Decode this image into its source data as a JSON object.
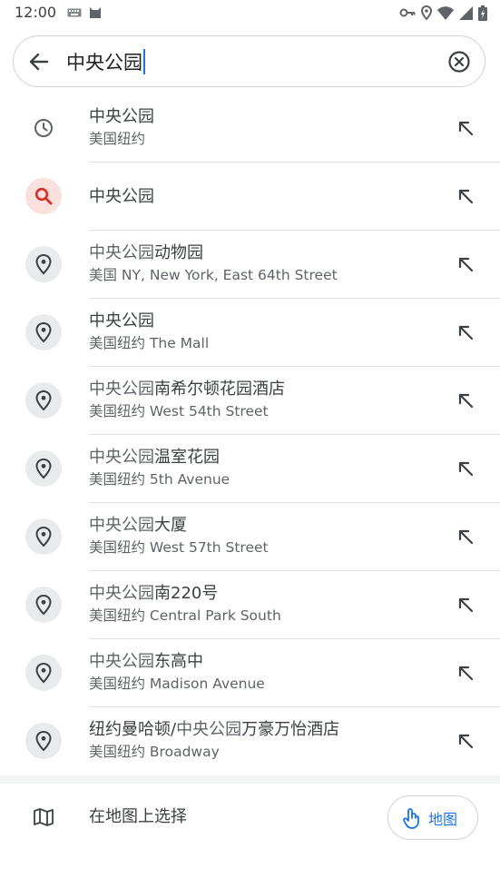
{
  "status_bar": {
    "time": "12:00"
  },
  "search": {
    "query": "中央公园"
  },
  "results": [
    {
      "type": "history",
      "icon": "clock-icon",
      "primary_muted": "",
      "primary": "中央公园",
      "secondary": "美国纽约"
    },
    {
      "type": "query",
      "icon": "search-icon",
      "primary_muted": "",
      "primary": "中央公园",
      "secondary": ""
    },
    {
      "type": "place",
      "icon": "place-pin-icon",
      "primary_muted": "中央公园",
      "primary": "动物园",
      "secondary": "美国 NY, New York, East 64th Street"
    },
    {
      "type": "place",
      "icon": "place-pin-icon",
      "primary_muted": "",
      "primary": "中央公园",
      "secondary": "美国纽约 The Mall"
    },
    {
      "type": "place",
      "icon": "place-pin-icon",
      "primary_muted": "中央公园",
      "primary": "南希尔顿花园酒店",
      "secondary": "美国纽约 West 54th Street"
    },
    {
      "type": "place",
      "icon": "place-pin-icon",
      "primary_muted": "中央公园",
      "primary": "温室花园",
      "secondary": "美国纽约 5th Avenue"
    },
    {
      "type": "place",
      "icon": "place-pin-icon",
      "primary_muted": "中央公园",
      "primary": "大厦",
      "secondary": "美国纽约 West 57th Street"
    },
    {
      "type": "place",
      "icon": "place-pin-icon",
      "primary_muted": "中央公园",
      "primary": "南220号",
      "secondary": "美国纽约 Central Park South"
    },
    {
      "type": "place",
      "icon": "place-pin-icon",
      "primary_muted": "中央公园",
      "primary": "东高中",
      "secondary": "美国纽约 Madison Avenue"
    },
    {
      "type": "place",
      "icon": "place-pin-icon",
      "primary_pre": "纽约曼哈顿/",
      "primary_muted": "中央公园",
      "primary": "万豪万怡酒店",
      "secondary": "美国纽约 Broadway"
    }
  ],
  "bottom_bar": {
    "label": "在地图上选择",
    "chip_label": "地图"
  },
  "colors": {
    "accent": "#1a73e8",
    "search_icon": "#d93025",
    "search_icon_bg": "#fce0de",
    "icon_bg": "#e9eaec",
    "divider": "#dfe1e5"
  }
}
